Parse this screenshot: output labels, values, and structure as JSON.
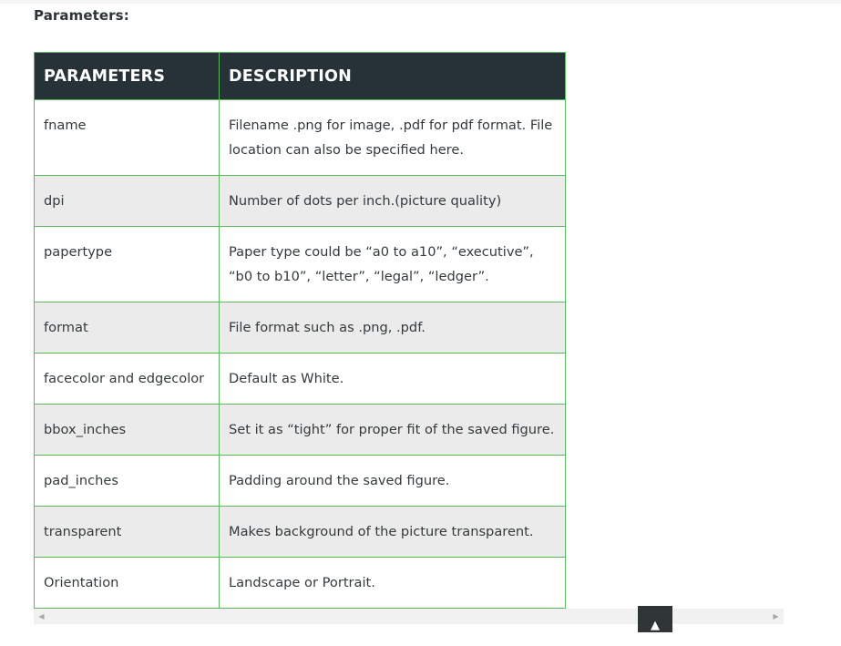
{
  "heading": "Parameters:",
  "table": {
    "headers": [
      "PARAMETERS",
      "DESCRIPTION"
    ],
    "rows": [
      {
        "param": "fname",
        "desc": "Filename .png for image, .pdf for pdf format. File location can also be specified here."
      },
      {
        "param": "dpi",
        "desc": "Number of dots per inch.(picture quality)"
      },
      {
        "param": "papertype",
        "desc": "Paper type could be “a0 to a10”, “executive”, “b0 to b10”, “letter”, “legal”, “ledger”."
      },
      {
        "param": "format",
        "desc": "File format such as .png, .pdf."
      },
      {
        "param": "facecolor and edgecolor",
        "desc": "Default as White."
      },
      {
        "param": "bbox_inches",
        "desc": "Set it as “tight” for proper fit of the saved figure."
      },
      {
        "param": "pad_inches",
        "desc": "Padding around the saved figure."
      },
      {
        "param": "transparent",
        "desc": "Makes background of the picture transparent."
      },
      {
        "param": "Orientation",
        "desc": "Landscape or Portrait."
      }
    ]
  },
  "scrollbar": {
    "left_icon": "triangle-left-icon",
    "right_icon": "triangle-right-icon",
    "left_glyph": "◀",
    "right_glyph": "▶"
  },
  "back_to_top": {
    "icon": "triangle-up-icon",
    "glyph": "▲"
  },
  "colors": {
    "header_bg": "#263238",
    "border": "#5cb85c",
    "stripe": "#ebebeb"
  }
}
